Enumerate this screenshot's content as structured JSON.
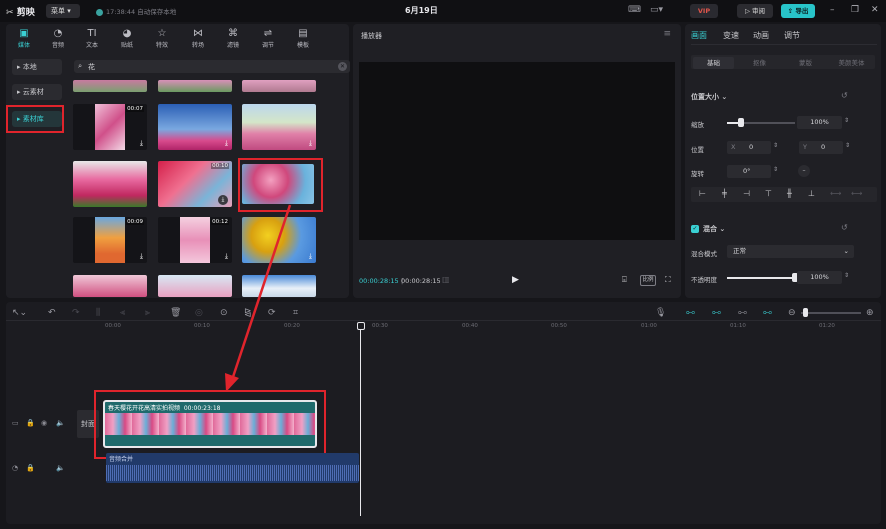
{
  "titlebar": {
    "app_name": "剪映",
    "menu": "菜单",
    "autosave": "17:38:44 自动保存本地",
    "project_name": "6月19日",
    "vip": "VIP",
    "review": "审阅",
    "export": "导出"
  },
  "media_tabs": [
    {
      "label": "媒体",
      "icon": "media-icon"
    },
    {
      "label": "音频",
      "icon": "audio-icon"
    },
    {
      "label": "文本",
      "icon": "text-icon"
    },
    {
      "label": "贴纸",
      "icon": "sticker-icon"
    },
    {
      "label": "特效",
      "icon": "effects-icon"
    },
    {
      "label": "转场",
      "icon": "transition-icon"
    },
    {
      "label": "滤镜",
      "icon": "filter-icon"
    },
    {
      "label": "调节",
      "icon": "adjust-icon"
    },
    {
      "label": "模板",
      "icon": "template-icon"
    }
  ],
  "side_nav": [
    {
      "label": "本地"
    },
    {
      "label": "云素材"
    },
    {
      "label": "素材库"
    }
  ],
  "search": {
    "value": "花"
  },
  "library_items": [
    {
      "duration": "00:07"
    },
    {
      "duration": "00:10"
    },
    {
      "duration": "00:09"
    },
    {
      "duration": "00:12"
    }
  ],
  "player": {
    "title": "播放器",
    "current_time": "00:00:28:15",
    "total_time": "00:00:28:15",
    "ratio": "比例"
  },
  "right_panel": {
    "tabs": [
      "画面",
      "变速",
      "动画",
      "调节"
    ],
    "subtabs": [
      "基础",
      "抠像",
      "蒙版",
      "美颜美体"
    ],
    "section_position": "位置大小",
    "scale_label": "缩放",
    "scale_value": "100%",
    "position_label": "位置",
    "x_label": "X",
    "x_value": "0",
    "y_label": "Y",
    "y_value": "0",
    "rotate_label": "旋转",
    "rotate_value": "0°",
    "section_blend": "混合",
    "blend_mode_label": "混合模式",
    "blend_mode_value": "正常",
    "opacity_label": "不透明度",
    "opacity_value": "100%",
    "scale_fraction": 0.2,
    "opacity_fraction": 1.0
  },
  "timeline": {
    "ruler": [
      "00:00",
      "00:10",
      "00:20",
      "00:30",
      "00:40",
      "00:50",
      "01:00",
      "01:10",
      "01:20"
    ],
    "cover_label": "封面",
    "clip_title": "春天樱花开花高清实拍视频",
    "clip_duration": "00:00:23:18",
    "audio_label": "音频合并"
  },
  "colors": {
    "accent": "#28c4c9",
    "highlight": "#e0242c"
  }
}
